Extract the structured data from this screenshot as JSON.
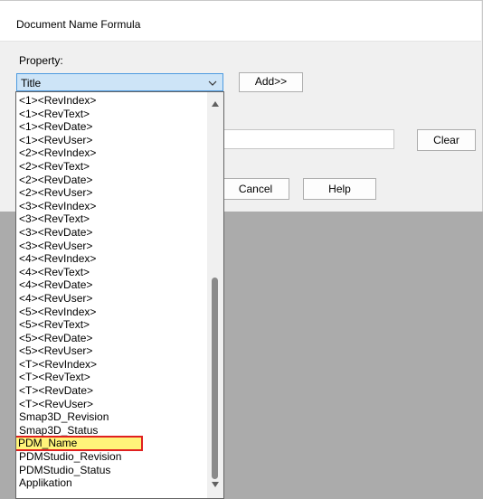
{
  "dialog": {
    "title": "Document Name Formula",
    "property_label": "Property:",
    "combo_value": "Title",
    "add_label": "Add>>",
    "clear_label": "Clear",
    "cancel_label": "Cancel",
    "help_label": "Help",
    "formula_value": ""
  },
  "dropdown": {
    "items": [
      "<1><RevIndex>",
      "<1><RevText>",
      "<1><RevDate>",
      "<1><RevUser>",
      "<2><RevIndex>",
      "<2><RevText>",
      "<2><RevDate>",
      "<2><RevUser>",
      "<3><RevIndex>",
      "<3><RevText>",
      "<3><RevDate>",
      "<3><RevUser>",
      "<4><RevIndex>",
      "<4><RevText>",
      "<4><RevDate>",
      "<4><RevUser>",
      "<5><RevIndex>",
      "<5><RevText>",
      "<5><RevDate>",
      "<5><RevUser>",
      "<T><RevIndex>",
      "<T><RevText>",
      "<T><RevDate>",
      "<T><RevUser>",
      "Smap3D_Revision",
      "Smap3D_Status",
      "PDM_Name",
      "PDMStudio_Revision",
      "PDMStudio_Status",
      "Applikation"
    ],
    "highlighted_item": "PDM_Name",
    "highlight_color": "#fff47a",
    "highlight_border_color": "#e02020"
  },
  "colors": {
    "combo_bg": "#cde4f7",
    "combo_border": "#4d9be0",
    "backdrop": "#ababab"
  },
  "icons": {
    "combo_arrow": "chevron-down-icon",
    "scroll_up": "scroll-up-arrow-icon",
    "scroll_down": "scroll-down-arrow-icon"
  }
}
